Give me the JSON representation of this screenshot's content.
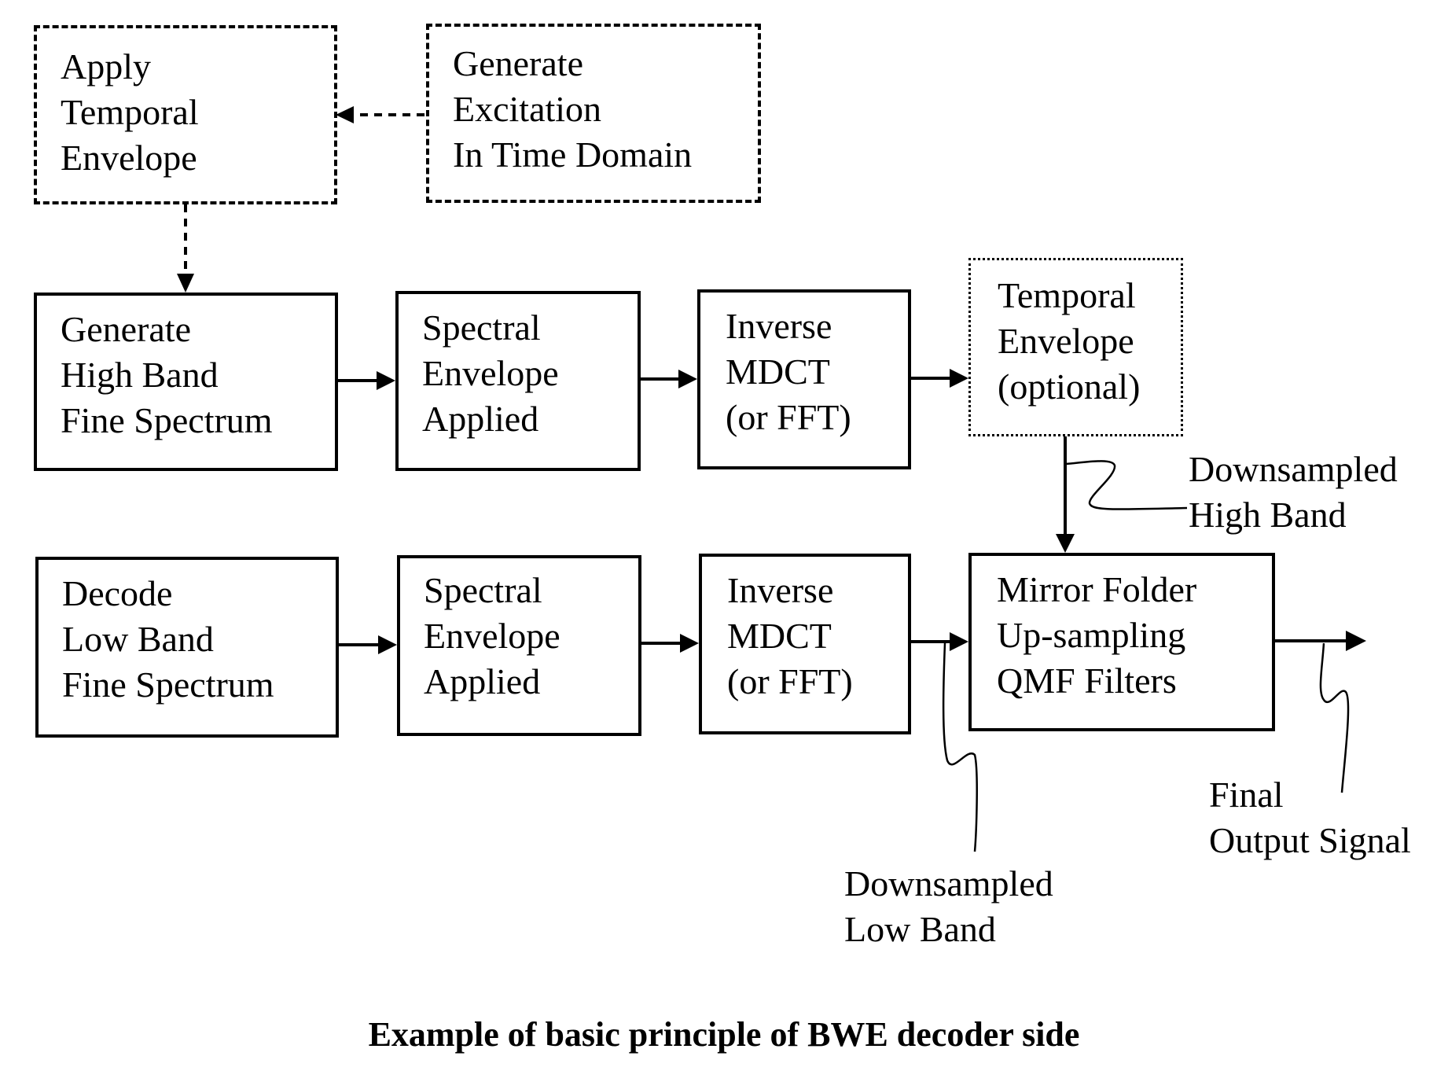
{
  "diagram": {
    "caption": "Example of basic principle of BWE decoder side",
    "blocks": {
      "apply_temporal_envelope": {
        "style": "dashed",
        "lines": [
          "Apply",
          "Temporal",
          "Envelope"
        ]
      },
      "generate_excitation": {
        "style": "dashed",
        "lines": [
          "Generate",
          "Excitation",
          "In Time Domain"
        ]
      },
      "generate_high_band": {
        "style": "solid",
        "lines": [
          "Generate",
          "High Band",
          "Fine Spectrum"
        ]
      },
      "spectral_envelope_high": {
        "style": "solid",
        "lines": [
          "Spectral",
          "Envelope",
          "Applied"
        ]
      },
      "inverse_mdct_high": {
        "style": "solid",
        "lines": [
          "Inverse",
          "MDCT",
          "(or FFT)"
        ]
      },
      "temporal_envelope_optional": {
        "style": "dotted",
        "lines": [
          "Temporal",
          "Envelope",
          "(optional)"
        ]
      },
      "decode_low_band": {
        "style": "solid",
        "lines": [
          "Decode",
          "Low Band",
          "Fine Spectrum"
        ]
      },
      "spectral_envelope_low": {
        "style": "solid",
        "lines": [
          "Spectral",
          "Envelope",
          "Applied"
        ]
      },
      "inverse_mdct_low": {
        "style": "solid",
        "lines": [
          "Inverse",
          "MDCT",
          "(or FFT)"
        ]
      },
      "mirror_folder": {
        "style": "solid",
        "lines": [
          "Mirror Folder",
          "Up-sampling",
          "QMF Filters"
        ]
      }
    },
    "annotations": {
      "downsampled_high_band": [
        "Downsampled",
        "High Band"
      ],
      "downsampled_low_band": [
        "Downsampled",
        "Low Band"
      ],
      "final_output_signal": [
        "Final",
        "Output Signal"
      ]
    },
    "connections": [
      {
        "from": "generate_excitation",
        "to": "apply_temporal_envelope",
        "style": "dashed"
      },
      {
        "from": "apply_temporal_envelope",
        "to": "generate_high_band",
        "style": "dashed"
      },
      {
        "from": "generate_high_band",
        "to": "spectral_envelope_high",
        "style": "solid"
      },
      {
        "from": "spectral_envelope_high",
        "to": "inverse_mdct_high",
        "style": "solid"
      },
      {
        "from": "inverse_mdct_high",
        "to": "temporal_envelope_optional",
        "style": "solid"
      },
      {
        "from": "temporal_envelope_optional",
        "to": "mirror_folder",
        "style": "solid"
      },
      {
        "from": "decode_low_band",
        "to": "spectral_envelope_low",
        "style": "solid"
      },
      {
        "from": "spectral_envelope_low",
        "to": "inverse_mdct_low",
        "style": "solid"
      },
      {
        "from": "inverse_mdct_low",
        "to": "mirror_folder",
        "style": "solid"
      },
      {
        "from": "mirror_folder",
        "to": "output",
        "style": "solid"
      }
    ]
  }
}
